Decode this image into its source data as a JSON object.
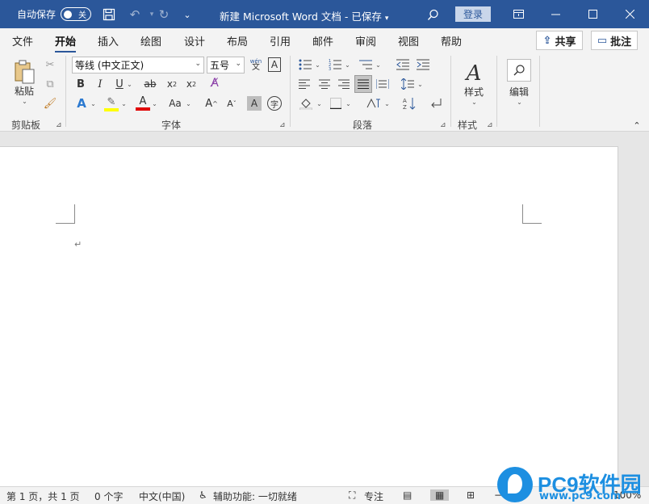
{
  "titlebar": {
    "autosave_label": "自动保存",
    "autosave_state": "关",
    "doc_title": "新建 Microsoft Word 文档  -  已保存",
    "login_label": "登录",
    "icons": [
      "save-icon",
      "undo-icon",
      "redo-icon",
      "customize-qat-icon",
      "search-icon",
      "ribbon-display-icon",
      "minimize-icon",
      "maximize-icon",
      "close-icon"
    ]
  },
  "tabs": [
    "文件",
    "开始",
    "插入",
    "绘图",
    "设计",
    "布局",
    "引用",
    "邮件",
    "审阅",
    "视图",
    "帮助"
  ],
  "share_label": "共享",
  "comments_label": "批注",
  "ribbon": {
    "clipboard": {
      "paste": "粘贴",
      "label": "剪贴板"
    },
    "font": {
      "font_name": "等线 (中文正文)",
      "font_size": "五号",
      "phonetic": "wén",
      "phonetic_sub": "文",
      "label": "字体"
    },
    "paragraph": {
      "label": "段落"
    },
    "styles": {
      "styles_btn": "样式",
      "label": "样式"
    },
    "editing": {
      "edit_btn": "编辑"
    }
  },
  "status": {
    "page": "第 1 页，共 1 页",
    "words": "0 个字",
    "lang": "中文(中国)",
    "accessibility": "辅助功能: 一切就绪",
    "focus": "专注",
    "zoom": "100%"
  },
  "watermark": {
    "brand": "PC9软件园",
    "url": "www.pc9.com"
  },
  "colors": {
    "accent": "#2b579a",
    "highlight": "#ffff00",
    "font_color": "#e00000"
  }
}
